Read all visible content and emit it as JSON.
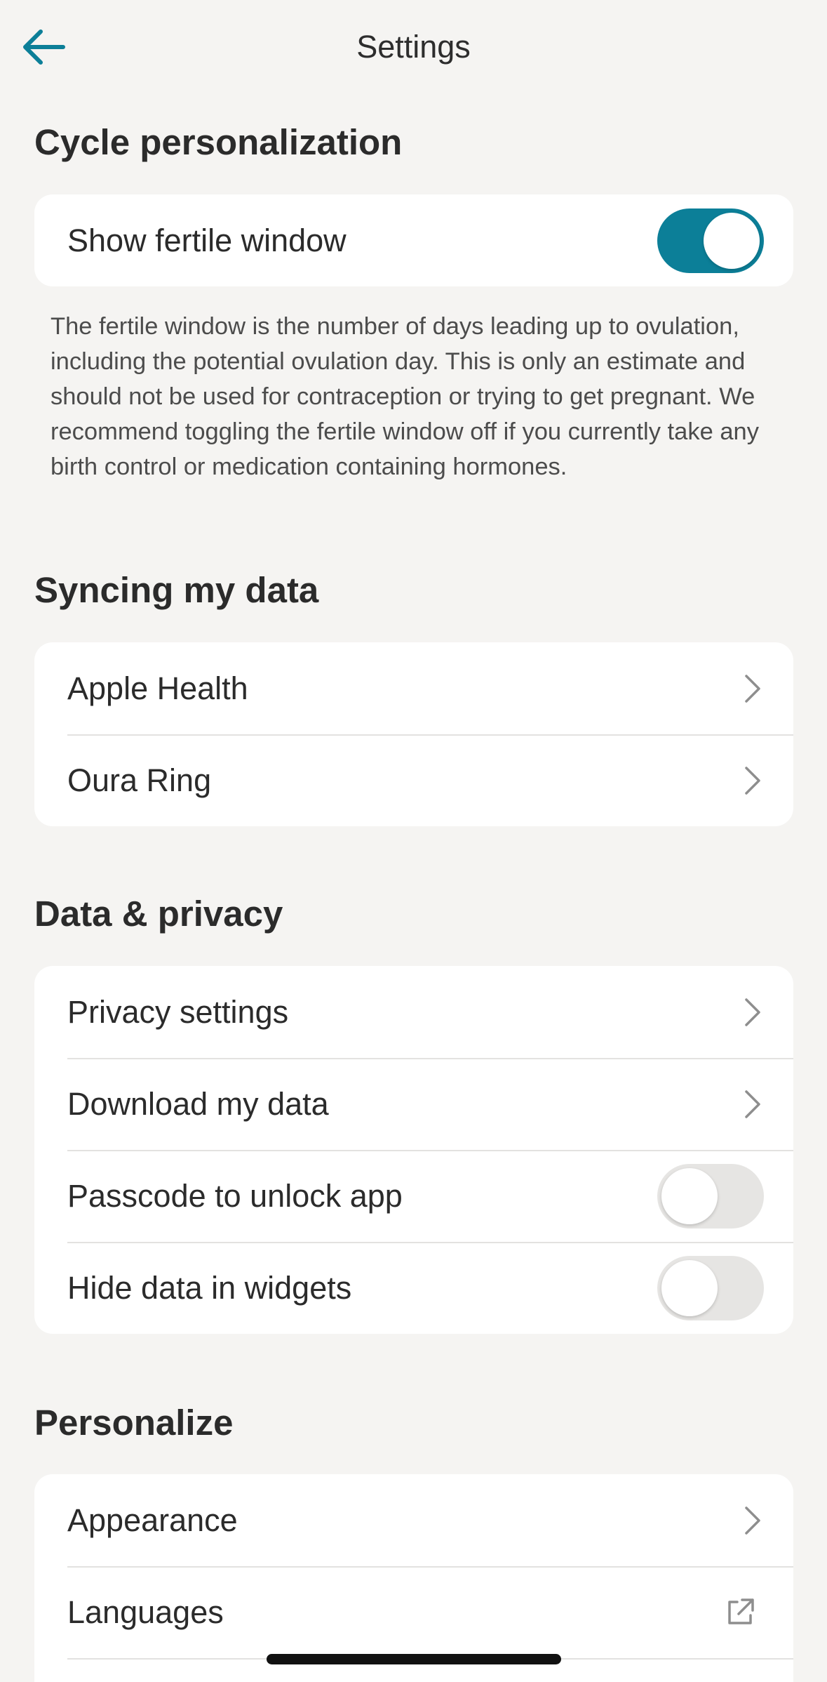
{
  "header": {
    "title": "Settings",
    "back_icon": "back-arrow-icon"
  },
  "colors": {
    "accent": "#0c7f98",
    "background": "#f5f4f2",
    "card": "#ffffff"
  },
  "cycle": {
    "title": "Cycle personalization",
    "fertile_label": "Show fertile window",
    "fertile_on": true,
    "description": "The fertile window is the number of days leading up to ovulation, including the potential ovulation day. This is only an estimate and should not be used for contraception or trying to get pregnant. We recommend toggling the fertile window off if you currently take any birth control or medication containing hormones."
  },
  "syncing": {
    "title": "Syncing my data",
    "items": [
      {
        "label": "Apple Health"
      },
      {
        "label": "Oura Ring"
      }
    ]
  },
  "privacy": {
    "title": "Data & privacy",
    "items": [
      {
        "label": "Privacy settings"
      },
      {
        "label": "Download my data"
      },
      {
        "label": "Passcode to unlock app",
        "toggle_on": false
      },
      {
        "label": "Hide data in widgets",
        "toggle_on": false
      }
    ]
  },
  "personalize": {
    "title": "Personalize",
    "items": [
      {
        "label": "Appearance"
      },
      {
        "label": "Languages",
        "icon": "external-link-icon"
      }
    ]
  }
}
